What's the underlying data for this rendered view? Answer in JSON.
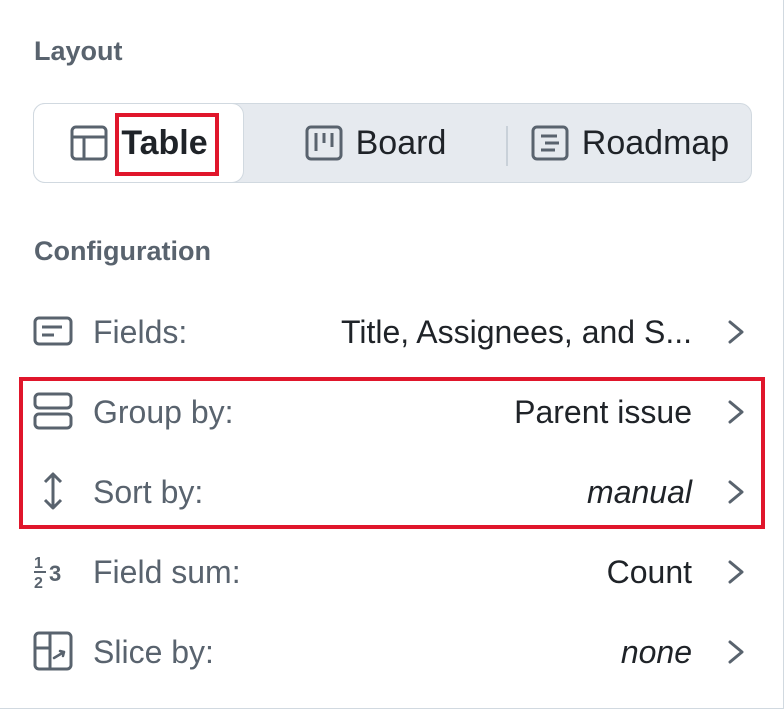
{
  "layout": {
    "title": "Layout",
    "options": [
      {
        "label": "Table",
        "icon": "table-icon",
        "selected": true
      },
      {
        "label": "Board",
        "icon": "board-icon",
        "selected": false
      },
      {
        "label": "Roadmap",
        "icon": "roadmap-icon",
        "selected": false
      }
    ]
  },
  "configuration": {
    "title": "Configuration",
    "rows": [
      {
        "label": "Fields:",
        "value": "Title, Assignees, and S...",
        "icon": "fields-icon",
        "italic": false
      },
      {
        "label": "Group by:",
        "value": "Parent issue",
        "icon": "group-icon",
        "italic": false
      },
      {
        "label": "Sort by:",
        "value": "manual",
        "icon": "sort-icon",
        "italic": true
      },
      {
        "label": "Field sum:",
        "value": "Count",
        "icon": "field-sum-icon",
        "italic": false
      },
      {
        "label": "Slice by:",
        "value": "none",
        "icon": "slice-icon",
        "italic": true
      }
    ]
  },
  "colors": {
    "highlight": "#e0162b",
    "label": "#59636e",
    "text": "#1f2328",
    "segment_bg": "#e6eaef"
  }
}
